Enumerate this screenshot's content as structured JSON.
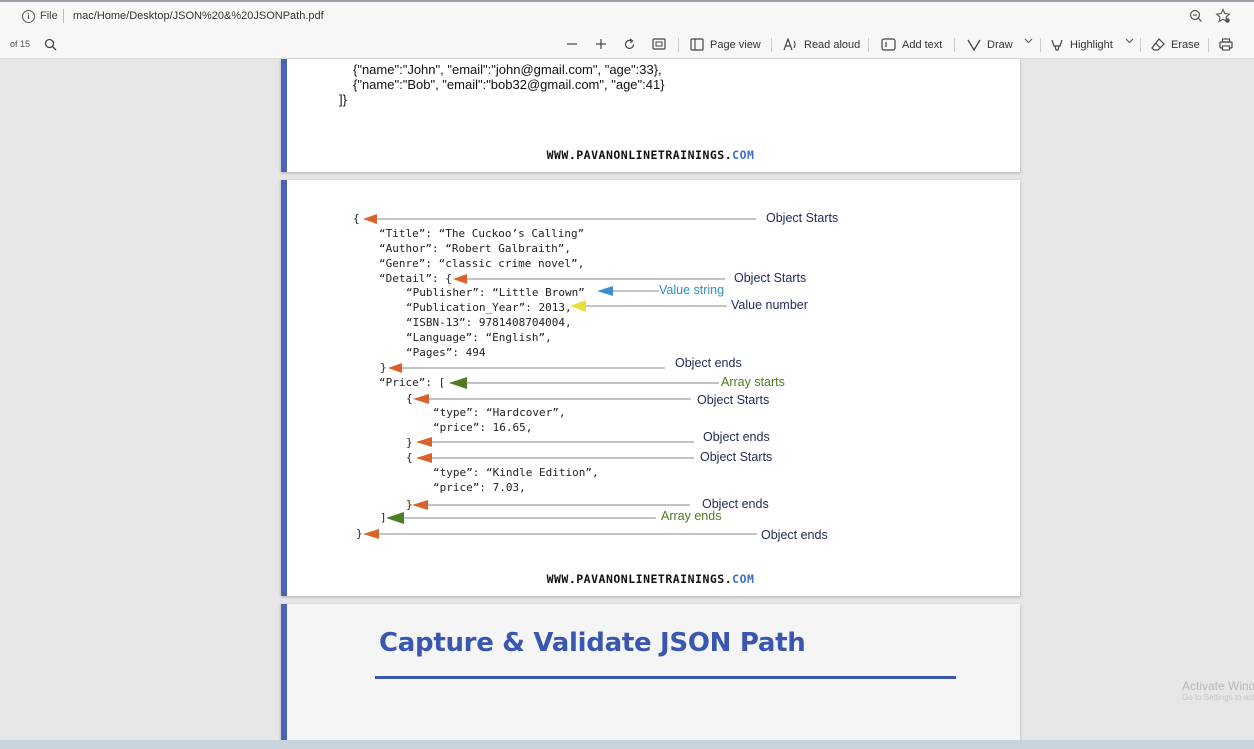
{
  "address_bar": {
    "file_label": "File",
    "url": "mac/Home/Desktop/JSON%20&%20JSONPath.pdf"
  },
  "toolbar": {
    "page_of": "of 15",
    "page_view": "Page view",
    "read_aloud": "Read aloud",
    "add_text": "Add text",
    "draw": "Draw",
    "highlight": "Highlight",
    "erase": "Erase"
  },
  "page1": {
    "lines": [
      "{\"name\":\"John\", \"email\":\"john@gmail.com\", \"age\":33},",
      "{\"name\":\"Bob\", \"email\":\"bob32@gmail.com\", \"age\":41}",
      "]}"
    ],
    "footer": {
      "main": "WWW.PAVANONLINETRAININGS.",
      "tld": "COM"
    }
  },
  "page2": {
    "code": [
      "{",
      "“Title”: “The Cuckoo’s Calling”",
      "“Author”: “Robert Galbraith”,",
      "“Genre”: “classic crime novel”,",
      "“Detail”: {",
      "“Publisher”: “Little Brown”",
      "“Publication_Year”: 2013,",
      "“ISBN-13”: 9781408704004,",
      "“Language”: “English”,",
      "“Pages”: 494",
      "}",
      "“Price”: [",
      "{",
      "“type”: “Hardcover”,",
      "“price”: 16.65,",
      "}",
      "{",
      "“type”: “Kindle Edition”,",
      "“price”: 7.03,",
      "}",
      "]",
      "}"
    ],
    "annotations": [
      "Object Starts",
      "Object Starts",
      "Value string",
      "Value number",
      "Object ends",
      "Array starts",
      "Object Starts",
      "Object ends",
      "Object Starts",
      "Object ends",
      "Array ends",
      "Object ends"
    ],
    "footer": {
      "main": "WWW.PAVANONLINETRAININGS.",
      "tld": "COM"
    },
    "colors": {
      "orange": "#d9622b",
      "blue": "#3a8ed0",
      "yellow": "#e8e03a",
      "green": "#4f7b22"
    }
  },
  "page3": {
    "title": "Capture & Validate JSON Path"
  },
  "watermark": {
    "line1": "Activate Windows",
    "line2": "Go to Settings to activate Windows."
  }
}
